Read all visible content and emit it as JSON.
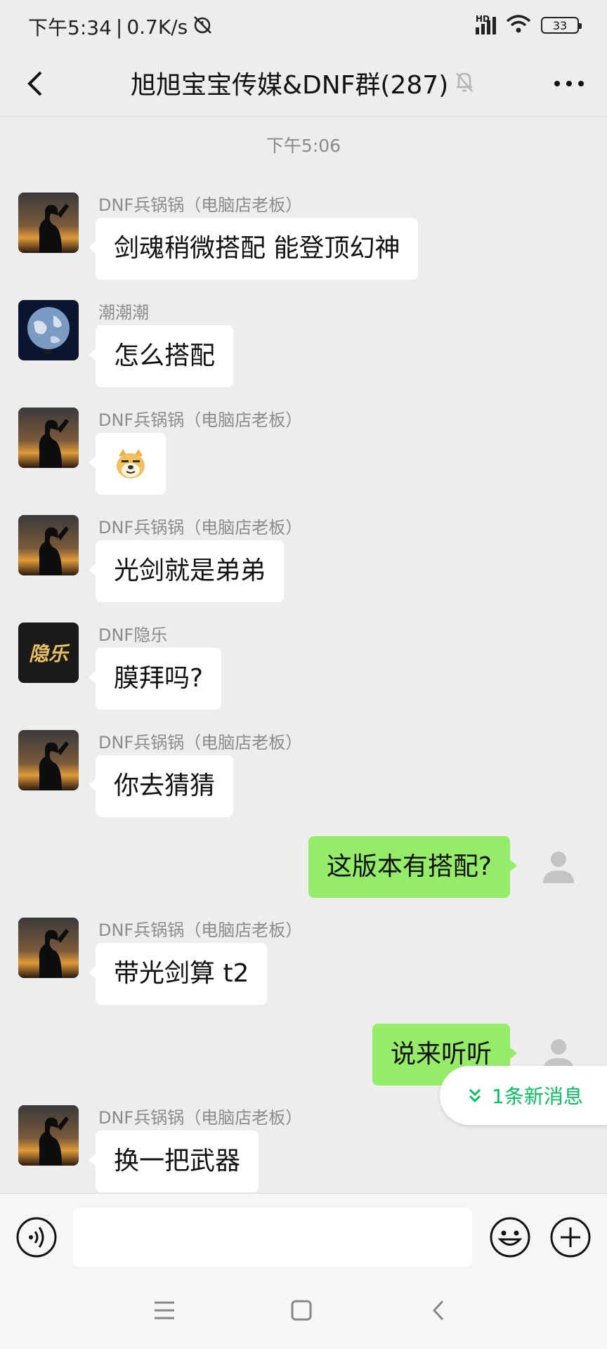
{
  "status_bar": {
    "time": "下午5:34",
    "speed": "0.7K/s",
    "network": "HD",
    "battery": "33"
  },
  "nav": {
    "title": "旭旭宝宝传媒&DNF群(287)"
  },
  "chat": {
    "time_label": "下午5:06",
    "messages": [
      {
        "sender": "DNF兵锅锅（电脑店老板）",
        "text": "剑魂稍微搭配 能登顶幻神",
        "avatar": "salute-silhouette-avatar"
      },
      {
        "sender": "潮潮潮",
        "text": "怎么搭配",
        "avatar": "earth-avatar"
      },
      {
        "sender": "DNF兵锅锅（电脑店老板）",
        "text": "",
        "emoji": "doge-sticker",
        "avatar": "salute-silhouette-avatar"
      },
      {
        "sender": "DNF兵锅锅（电脑店老板）",
        "text": "光剑就是弟弟",
        "avatar": "salute-silhouette-avatar"
      },
      {
        "sender": "DNF隐乐",
        "text": "膜拜吗?",
        "avatar": "calligraphy-avatar",
        "avatar_text": "隐乐"
      },
      {
        "sender": "DNF兵锅锅（电脑店老板）",
        "text": "你去猜猜",
        "avatar": "salute-silhouette-avatar"
      },
      {
        "mine": true,
        "text": "这版本有搭配?"
      },
      {
        "sender": "DNF兵锅锅（电脑店老板）",
        "text": "带光剑算 t2",
        "avatar": "salute-silhouette-avatar"
      },
      {
        "mine": true,
        "text": "说来听听"
      },
      {
        "sender": "DNF兵锅锅（电脑店老板）",
        "text": "换一把武器",
        "avatar": "salute-silhouette-avatar"
      }
    ]
  },
  "new_messages": "1条新消息",
  "input": {
    "placeholder": ""
  },
  "colors": {
    "background": "#ededed",
    "my_bubble": "#95ec69",
    "other_bubble": "#ffffff",
    "accent": "#07c160"
  }
}
